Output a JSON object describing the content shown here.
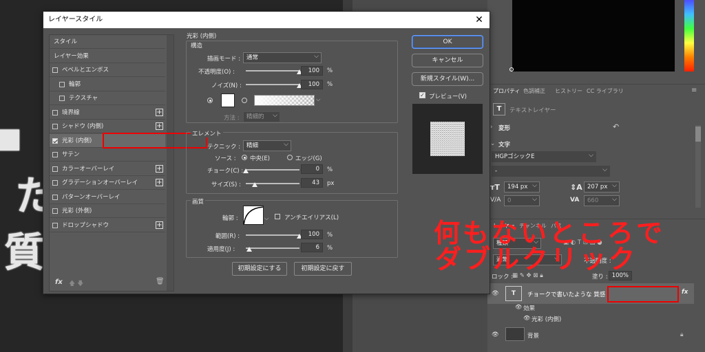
{
  "dialog": {
    "title": "レイヤースタイル",
    "close": "✕",
    "styles": [
      {
        "label": "スタイル",
        "checkbox": false,
        "plus": false
      },
      {
        "label": "レイヤー効果",
        "checkbox": false,
        "plus": false
      },
      {
        "label": "ベベルとエンボス",
        "checkbox": true,
        "checked": false,
        "plus": false
      },
      {
        "label": "輪郭",
        "checkbox": true,
        "checked": false,
        "plus": false,
        "indent": true
      },
      {
        "label": "テクスチャ",
        "checkbox": true,
        "checked": false,
        "plus": false,
        "indent": true
      },
      {
        "label": "境界線",
        "checkbox": true,
        "checked": false,
        "plus": true
      },
      {
        "label": "シャドウ (内側)",
        "checkbox": true,
        "checked": false,
        "plus": true
      },
      {
        "label": "光彩 (内側)",
        "checkbox": true,
        "checked": true,
        "plus": false
      },
      {
        "label": "サテン",
        "checkbox": true,
        "checked": false,
        "plus": false
      },
      {
        "label": "カラーオーバーレイ",
        "checkbox": true,
        "checked": false,
        "plus": true
      },
      {
        "label": "グラデーションオーバーレイ",
        "checkbox": true,
        "checked": false,
        "plus": true
      },
      {
        "label": "パターンオーバーレイ",
        "checkbox": true,
        "checked": false,
        "plus": false
      },
      {
        "label": "光彩 (外側)",
        "checkbox": true,
        "checked": false,
        "plus": false
      },
      {
        "label": "ドロップシャドウ",
        "checkbox": true,
        "checked": false,
        "plus": true
      }
    ],
    "fx_label": "fx",
    "section_title": "光彩 (内側)",
    "structure": {
      "title": "構造",
      "blend_mode_label": "描画モード :",
      "blend_mode_value": "通常",
      "opacity_label": "不透明度(O) :",
      "opacity_value": "100",
      "opacity_fraction": 1.0,
      "noise_label": "ノイズ(N) :",
      "noise_value": "100",
      "noise_fraction": 1.0,
      "method_label": "方法 :",
      "method_value": "精細的"
    },
    "elements": {
      "title": "エレメント",
      "technique_label": "テクニック :",
      "technique_value": "精細",
      "source_label": "ソース :",
      "source_center": "中央(E)",
      "source_edge": "エッジ(G)",
      "choke_label": "チョーク(C) :",
      "choke_value": "0",
      "choke_fraction": 0.0,
      "size_label": "サイズ(S) :",
      "size_value": "43",
      "size_fraction": 0.172
    },
    "quality": {
      "title": "画質",
      "contour_label": "輪郭 :",
      "antialias_label": "アンチエイリアス(L)",
      "range_label": "範囲(R) :",
      "range_value": "100",
      "range_fraction": 1.0,
      "jitter_label": "適用度(J) :",
      "jitter_value": "6",
      "jitter_fraction": 0.06
    },
    "units": {
      "percent": "%",
      "px": "px"
    },
    "make_default": "初期設定にする",
    "reset_default": "初期設定に戻す",
    "ok": "OK",
    "cancel": "キャンセル",
    "new_style": "新規スタイル(W)...",
    "preview": "プレビュー(V)"
  },
  "canvas": {
    "chalk_chars": [
      "た",
      "質"
    ]
  },
  "right_panel": {
    "tabs": [
      "プロパティ",
      "色調補正",
      "ヒストリー",
      "CC ライブラリ"
    ],
    "text_layer": "テキストレイヤー",
    "transform": "変形",
    "character": "文字",
    "font_family": "HGPゴシックE",
    "font_style": "-",
    "font_size": "194 px",
    "leading": "207 px",
    "kerning": "0",
    "tracking": "660",
    "layer_tabs": [
      "レイヤー",
      "チャンネル",
      "パス"
    ],
    "search_placeholder": "種類",
    "blend": "通常",
    "opacity_label": "不透明度 :",
    "lock_label": "ロック :",
    "fill_label": "塗り :",
    "fill_value": "100%",
    "layers": [
      {
        "name": "チョークで書いたような 質感",
        "type": "T"
      },
      {
        "name": "効果"
      },
      {
        "name": "光彩 (内側)"
      },
      {
        "name": "背景"
      }
    ]
  },
  "annotation": {
    "line1": "何もないところで",
    "line2": "ダブルクリック",
    "color": "#ff1e1e"
  }
}
